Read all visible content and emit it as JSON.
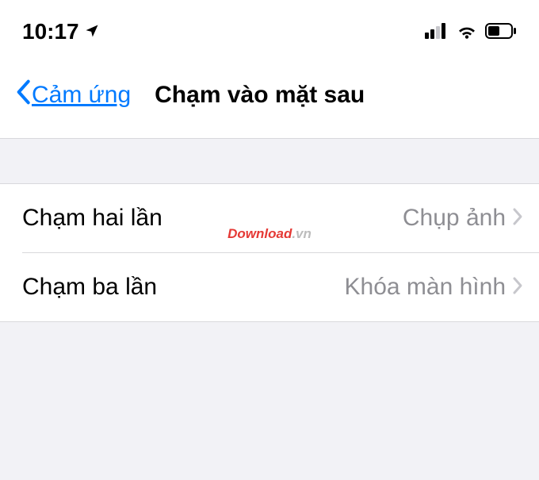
{
  "status_bar": {
    "time": "10:17",
    "location_icon": "location-arrow",
    "signal_icon": "cellular-signal",
    "wifi_icon": "wifi",
    "battery_icon": "battery-half"
  },
  "nav": {
    "back_label": "Cảm ứng",
    "title": "Chạm vào mặt sau"
  },
  "settings": [
    {
      "label": "Chạm hai lần",
      "value": "Chụp ảnh"
    },
    {
      "label": "Chạm ba lần",
      "value": "Khóa màn hình"
    }
  ],
  "watermark": {
    "part1": "Download",
    "part2": ".vn"
  }
}
